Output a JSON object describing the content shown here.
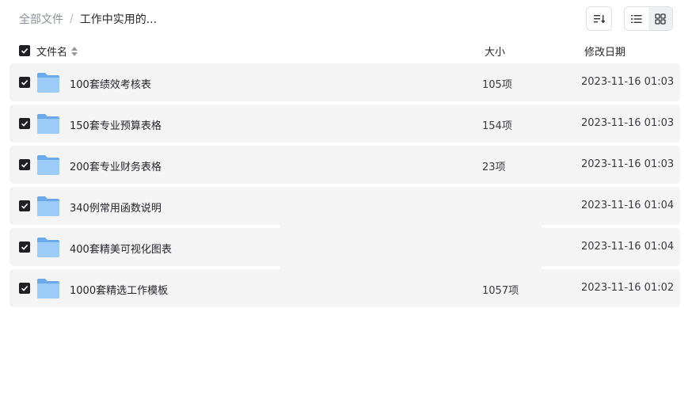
{
  "breadcrumb": {
    "root": "全部文件",
    "separator": "/",
    "current": "工作中实用的..."
  },
  "toolbar": {
    "sort_icon": "sort-icon",
    "list_view_icon": "list-view-icon",
    "grid_view_icon": "grid-view-icon"
  },
  "table": {
    "columns": {
      "name": "文件名",
      "size": "大小",
      "date": "修改日期"
    },
    "rows": [
      {
        "name": "100套绩效考核表",
        "size": "105项",
        "date": "2023-11-16 01:03"
      },
      {
        "name": "150套专业预算表格",
        "size": "154项",
        "date": "2023-11-16 01:03"
      },
      {
        "name": "200套专业财务表格",
        "size": "23项",
        "date": "2023-11-16 01:03"
      },
      {
        "name": "340例常用函数说明",
        "size": "",
        "date": "2023-11-16 01:04"
      },
      {
        "name": "400套精美可视化图表",
        "size": "",
        "date": "2023-11-16 01:04"
      },
      {
        "name": "1000套精选工作模板",
        "size": "1057项",
        "date": "2023-11-16 01:02"
      }
    ]
  },
  "colors": {
    "row_bg": "#f4f4f5",
    "checkbox": "#1f2024",
    "folder_blue": "#7cb8f2"
  }
}
